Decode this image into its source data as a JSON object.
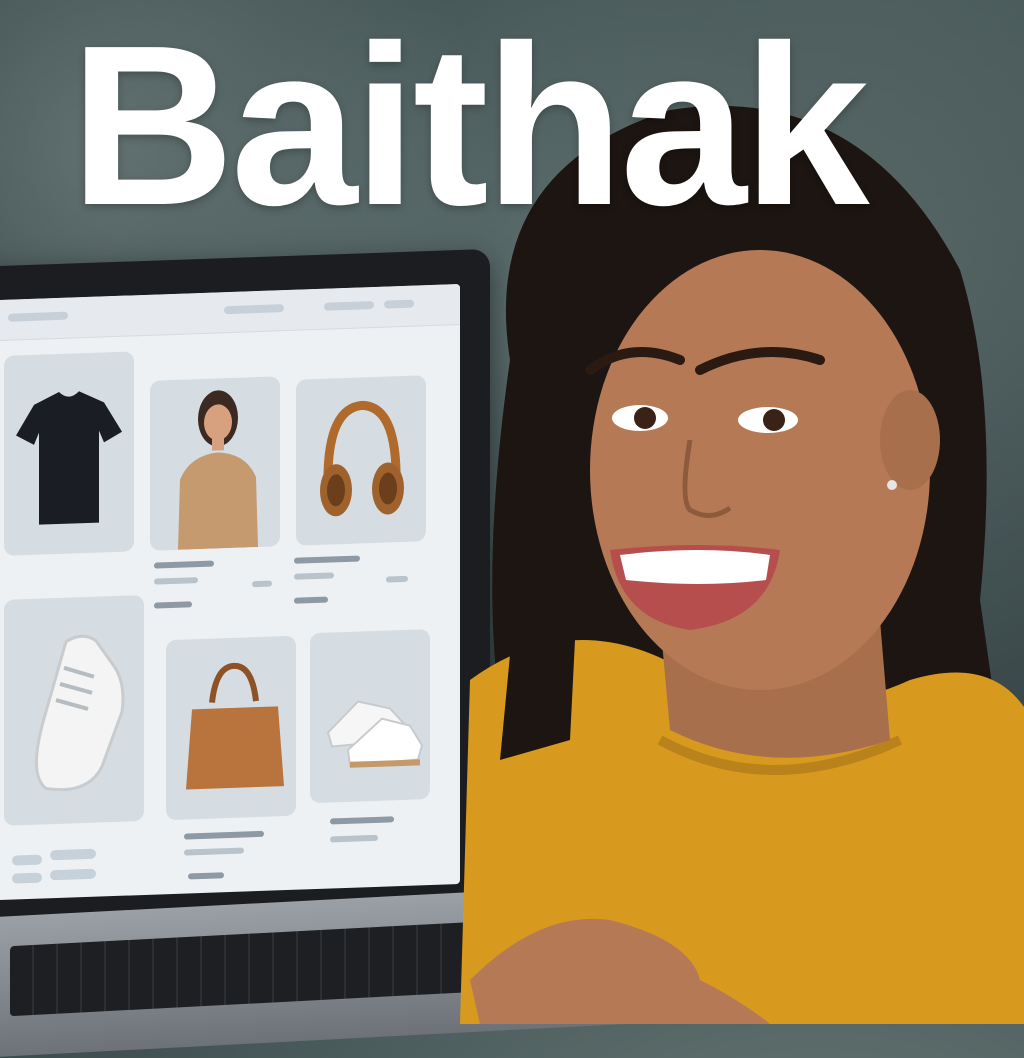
{
  "brand": {
    "name": "Baithak"
  },
  "scene": {
    "subject": "woman-shopping-online",
    "products": [
      "t-shirt-icon",
      "sweater-model-icon",
      "headphones-icon",
      "sneaker-icon",
      "handbag-icon",
      "shoes-icon"
    ]
  },
  "colors": {
    "sweater": "#d79a1f",
    "hair": "#1c1512",
    "skin": "#b57a55",
    "screen_bg": "#eef1f4",
    "card_bg": "#d5dde3"
  }
}
